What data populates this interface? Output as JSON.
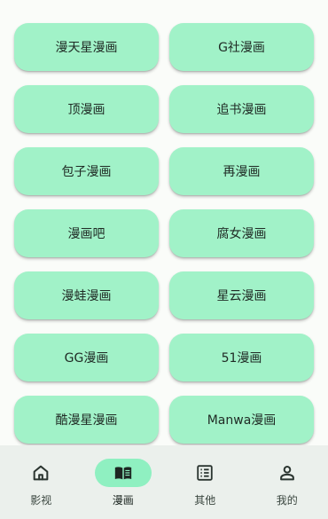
{
  "sources": [
    {
      "label": "漫天星漫画"
    },
    {
      "label": "G社漫画"
    },
    {
      "label": "顶漫画"
    },
    {
      "label": "追书漫画"
    },
    {
      "label": "包子漫画"
    },
    {
      "label": "再漫画"
    },
    {
      "label": "漫画吧"
    },
    {
      "label": "腐女漫画"
    },
    {
      "label": "漫蛙漫画"
    },
    {
      "label": "星云漫画"
    },
    {
      "label": "GG漫画"
    },
    {
      "label": "51漫画"
    },
    {
      "label": "酷漫星漫画"
    },
    {
      "label": "Manwa漫画"
    }
  ],
  "nav": {
    "items": [
      {
        "label": "影视",
        "icon": "home-icon"
      },
      {
        "label": "漫画",
        "icon": "book-icon",
        "active": true
      },
      {
        "label": "其他",
        "icon": "list-icon"
      },
      {
        "label": "我的",
        "icon": "person-icon"
      }
    ]
  },
  "colors": {
    "button_bg": "#a1f2c8",
    "nav_bg": "#ebf0ec",
    "nav_active_pill": "#8ff0c1",
    "page_bg": "#fafcf9"
  }
}
